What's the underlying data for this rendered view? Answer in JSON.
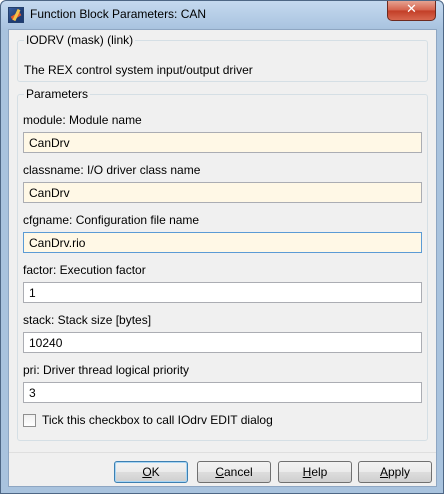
{
  "window": {
    "title": "Function Block Parameters: CAN",
    "close_glyph": "✕"
  },
  "header_group": {
    "title": "IODRV (mask) (link)",
    "description": "The REX control system input/output driver"
  },
  "parameters_group": {
    "title": "Parameters",
    "fields": [
      {
        "label": "module: Module name",
        "value": "CanDrv"
      },
      {
        "label": "classname: I/O driver class name",
        "value": "CanDrv"
      },
      {
        "label": "cfgname: Configuration file name",
        "value": "CanDrv.rio"
      },
      {
        "label": "factor: Execution factor",
        "value": "1"
      },
      {
        "label": "stack: Stack size [bytes]",
        "value": "10240"
      },
      {
        "label": "pri: Driver thread logical priority",
        "value": "3"
      }
    ],
    "checkbox_label": "Tick this checkbox to call IOdrv EDIT dialog",
    "checkbox_checked": false
  },
  "buttons": {
    "ok": {
      "mnemonic": "O",
      "rest": "K"
    },
    "cancel": {
      "mnemonic": "C",
      "rest": "ancel"
    },
    "help": {
      "mnemonic": "H",
      "rest": "elp"
    },
    "apply": {
      "mnemonic": "A",
      "rest": "pply"
    }
  },
  "colors": {
    "titlebar": "#aac4e0",
    "mask_field_bg": "#fff8e6",
    "close_button": "#c23d26"
  }
}
